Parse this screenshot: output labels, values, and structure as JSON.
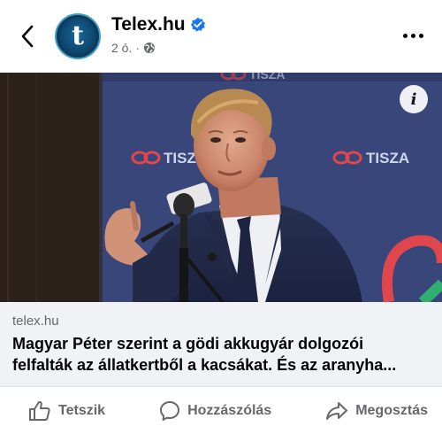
{
  "post": {
    "page_name": "Telex.hu",
    "avatar_letter": "t",
    "time": "2 ó.",
    "separator": "·",
    "icons": {
      "back": "chevron-left-icon",
      "verified": "verified-badge-icon",
      "audience": "globe-icon",
      "more": "more-dots-icon",
      "info": "info-icon"
    }
  },
  "media": {
    "info_label": "i",
    "backdrop_brand": "TISZA",
    "backdrop_brand_top": "TISZA"
  },
  "link": {
    "domain": "telex.hu",
    "title_line1": "Magyar Péter szerint a gödi akkugyár dolgozói",
    "title_line2": "felfalták az állatkertből a kacsákat. És az aranyha..."
  },
  "actions": {
    "like": "Tetszik",
    "comment": "Hozzászólás",
    "share": "Megosztás"
  },
  "colors": {
    "accent": "#1877f2",
    "secondary_text": "#65676b",
    "link_bg": "#f0f2f5",
    "brand_red": "#e0474c",
    "brand_green": "#2fae6f"
  }
}
